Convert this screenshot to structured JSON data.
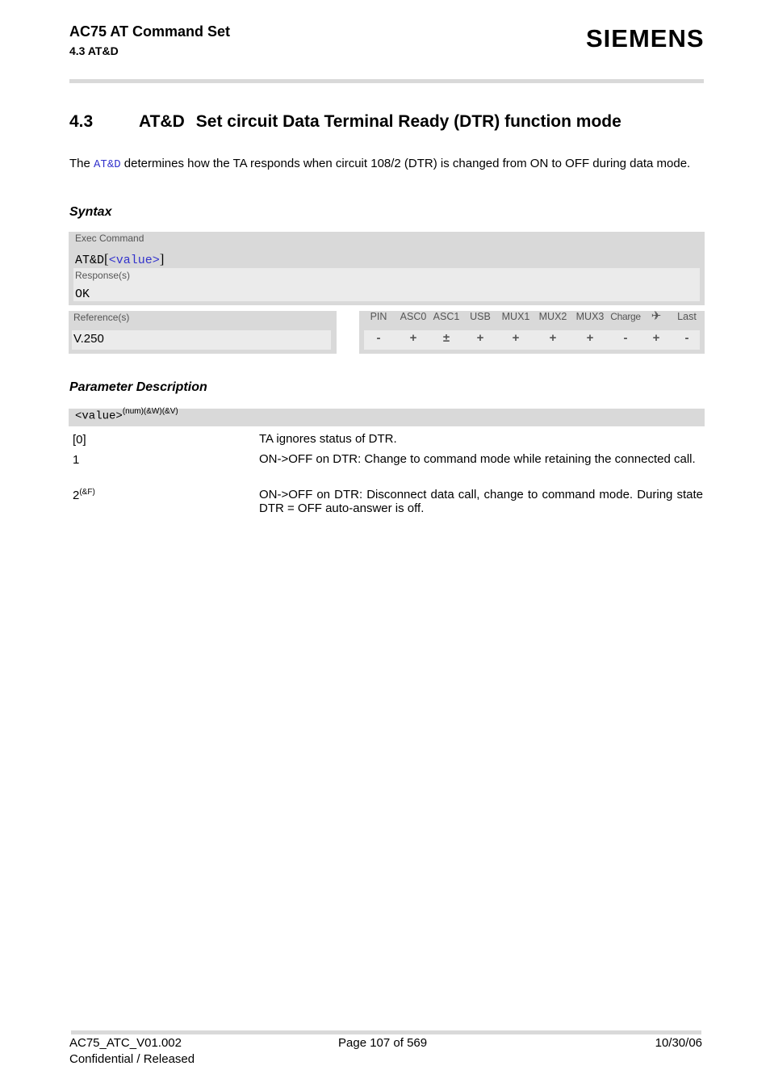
{
  "header": {
    "doc_title": "AC75 AT Command Set",
    "section_ref": "4.3 AT&D",
    "logo_text": "SIEMENS"
  },
  "section": {
    "number": "4.3",
    "command": "AT&D",
    "title": "Set circuit Data Terminal Ready (DTR) function mode"
  },
  "intro": {
    "prefix": "The ",
    "link": "AT&D",
    "suffix": " determines how the TA responds when circuit 108/2 (DTR) is changed from ON to OFF during data mode."
  },
  "syntax": {
    "heading": "Syntax",
    "exec_label": "Exec Command",
    "exec_cmd_prefix": "AT&D",
    "exec_bracket_open": "[",
    "exec_param": "<value>",
    "exec_bracket_close": "]",
    "response_label": "Response(s)",
    "response_value": "OK",
    "reference_label": "Reference(s)",
    "reference_value": "V.250",
    "columns": [
      {
        "header": "PIN",
        "value": "-"
      },
      {
        "header": "ASC0",
        "value": "+"
      },
      {
        "header": "ASC1",
        "value": "±"
      },
      {
        "header": "USB",
        "value": "+"
      },
      {
        "header": "MUX1",
        "value": "+"
      },
      {
        "header": "MUX2",
        "value": "+"
      },
      {
        "header": "MUX3",
        "value": "+"
      },
      {
        "header": "Charge",
        "value": "-"
      },
      {
        "header": "airplane-icon",
        "value": "+"
      },
      {
        "header": "Last",
        "value": "-"
      }
    ]
  },
  "params": {
    "heading": "Parameter Description",
    "name": "<value>",
    "name_sup": "(num)(&W)(&V)",
    "rows": [
      {
        "key": "[0]",
        "key_sup": "",
        "desc": "TA ignores status of DTR."
      },
      {
        "key": "1",
        "key_sup": "",
        "desc": "ON->OFF on DTR: Change to command mode while retaining the connected call."
      },
      {
        "key": "2",
        "key_sup": "(&F)",
        "desc": "ON->OFF on DTR: Disconnect data call, change to command mode. During state DTR = OFF auto-answer is off."
      }
    ]
  },
  "footer": {
    "doc_id": "AC75_ATC_V01.002",
    "status": "Confidential / Released",
    "page": "Page 107 of 569",
    "date": "10/30/06"
  }
}
